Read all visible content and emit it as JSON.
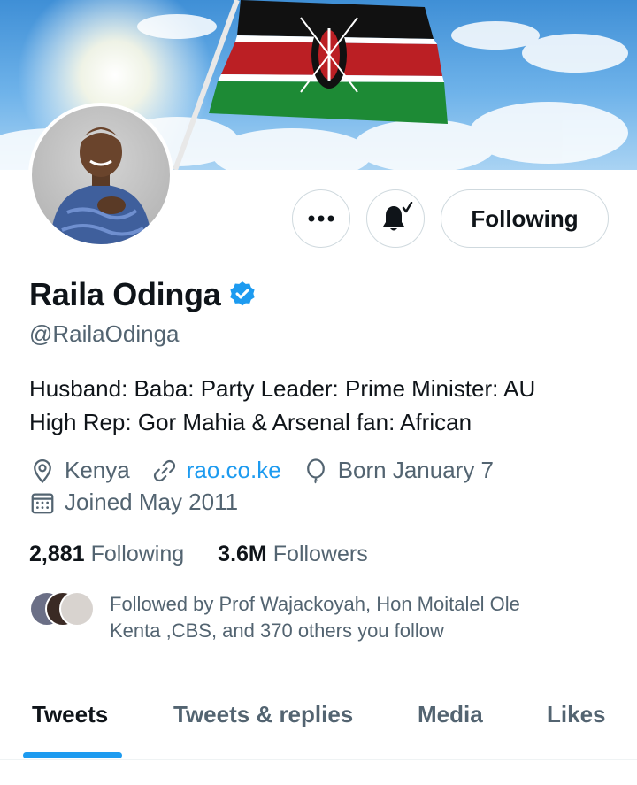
{
  "profile": {
    "name": "Raila Odinga",
    "handle": "@RailaOdinga",
    "bio_line1": "Husband: Baba: Party Leader: Prime Minister: AU",
    "bio_line2": "High Rep: Gor Mahia & Arsenal fan: African",
    "location": "Kenya",
    "website": "rao.co.ke",
    "birthday": "Born January 7",
    "joined": "Joined May 2011",
    "verified": true
  },
  "actions": {
    "more_icon": "more-horizontal-icon",
    "notify_icon": "bell-subscribed-icon",
    "following_label": "Following"
  },
  "stats": {
    "following_count": "2,881",
    "following_label": "Following",
    "followers_count": "3.6M",
    "followers_label": "Followers"
  },
  "followed_by": {
    "text_line1": "Followed by Prof Wajackoyah, Hon Moitalel Ole",
    "text_line2": "Kenta ,CBS, and 370 others you follow"
  },
  "tabs": [
    {
      "label": "Tweets",
      "active": true
    },
    {
      "label": "Tweets & replies",
      "active": false
    },
    {
      "label": "Media",
      "active": false
    },
    {
      "label": "Likes",
      "active": false
    }
  ],
  "colors": {
    "accent": "#1d9bf0",
    "text_primary": "#0f1419",
    "text_secondary": "#536471",
    "border": "#cfd9de"
  }
}
